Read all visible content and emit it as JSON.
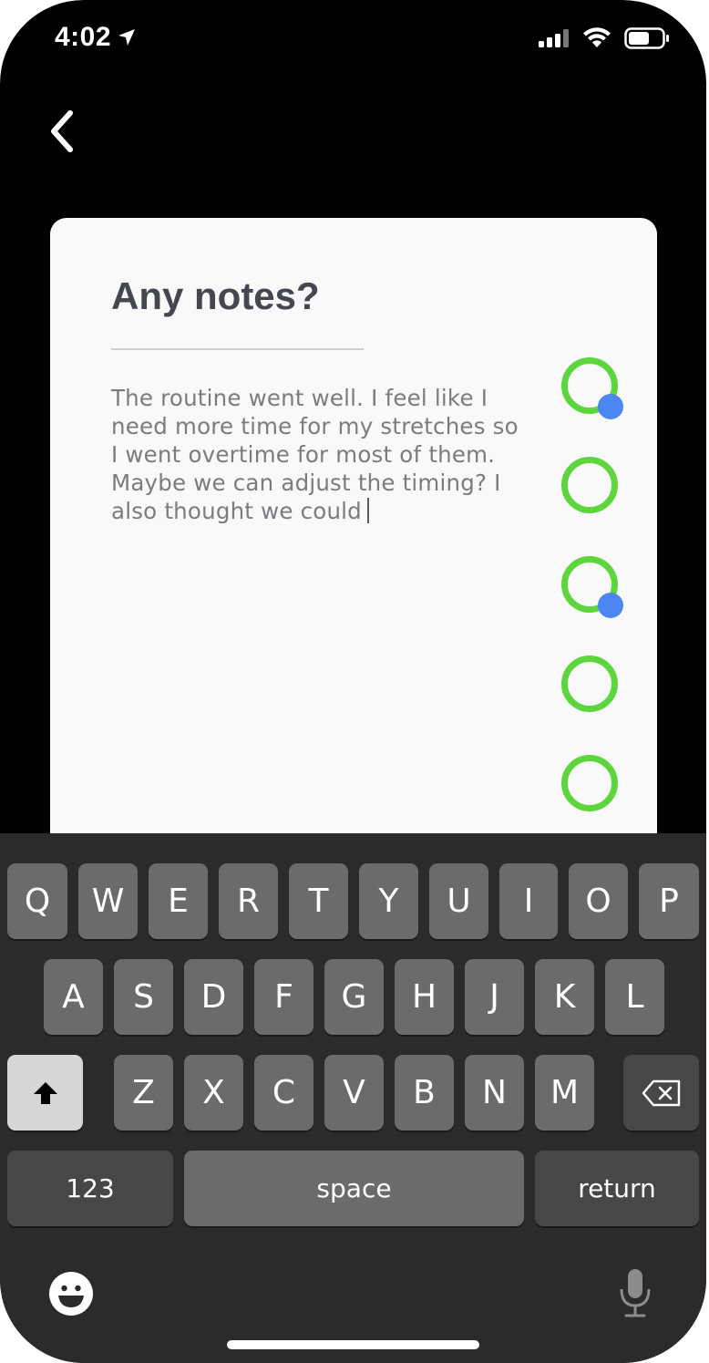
{
  "status_bar": {
    "time": "4:02"
  },
  "nav": {
    "back_icon": "chevron-left-icon"
  },
  "card": {
    "title": "Any notes?",
    "notes_text": "The routine went well. I feel like I need more time for my stretches so I went overtime for most of them. Maybe we can adjust the timing? I also thought we could",
    "rings": [
      {
        "completed": false,
        "has_badge": true
      },
      {
        "completed": false,
        "has_badge": false
      },
      {
        "completed": false,
        "has_badge": true
      },
      {
        "completed": false,
        "has_badge": false
      },
      {
        "completed": false,
        "has_badge": false
      }
    ]
  },
  "keyboard": {
    "row1": [
      "Q",
      "W",
      "E",
      "R",
      "T",
      "Y",
      "U",
      "I",
      "O",
      "P"
    ],
    "row2": [
      "A",
      "S",
      "D",
      "F",
      "G",
      "H",
      "J",
      "K",
      "L"
    ],
    "row3": [
      "Z",
      "X",
      "C",
      "V",
      "B",
      "N",
      "M"
    ],
    "numbers_label": "123",
    "space_label": "space",
    "return_label": "return"
  },
  "colors": {
    "ring": "#5dd63d",
    "badge": "#4b86f2",
    "card_bg": "#f9f9f9",
    "keyboard_bg": "#2b2b2b"
  }
}
